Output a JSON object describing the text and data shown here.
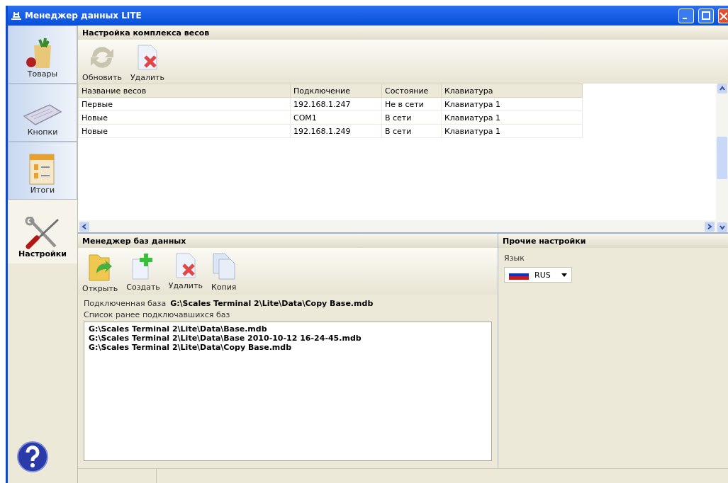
{
  "window": {
    "title": "Менеджер данных LITE"
  },
  "sidebar": {
    "items": [
      {
        "label": "Товары",
        "kind": "goods",
        "selected": false
      },
      {
        "label": "Кнопки",
        "kind": "keyboard",
        "selected": false
      },
      {
        "label": "Итоги",
        "kind": "totals",
        "selected": false
      },
      {
        "label": "Настройки",
        "kind": "tools",
        "selected": true
      }
    ]
  },
  "scales_panel": {
    "title": "Настройка комплекса весов",
    "toolbar": [
      {
        "label": "Обновить",
        "kind": "refresh"
      },
      {
        "label": "Удалить",
        "kind": "delete"
      }
    ],
    "table": {
      "columns": [
        "Название весов",
        "Подключение",
        "Состояние",
        "Клавиатура"
      ],
      "rows": [
        [
          "Первые",
          "192.168.1.247",
          "Не в сети",
          "Клавиатура 1"
        ],
        [
          "Новые",
          "COM1",
          "В сети",
          "Клавиатура 1"
        ],
        [
          "Новые",
          "192.168.1.249",
          "В сети",
          "Клавиатура 1"
        ]
      ]
    }
  },
  "db_panel": {
    "title": "Менеджер баз данных",
    "toolbar": [
      {
        "label": "Открыть",
        "kind": "open"
      },
      {
        "label": "Создать",
        "kind": "create"
      },
      {
        "label": "Удалить",
        "kind": "delete"
      },
      {
        "label": "Копия",
        "kind": "copy"
      }
    ],
    "connected_label": "Подключенная база",
    "connected_value": "G:\\Scales Terminal 2\\Lite\\Data\\Copy Base.mdb",
    "history_label": "Список ранее подключавшихся баз",
    "history": [
      "G:\\Scales Terminal 2\\Lite\\Data\\Base.mdb",
      "G:\\Scales Terminal 2\\Lite\\Data\\Base 2010-10-12 16-24-45.mdb",
      "G:\\Scales Terminal 2\\Lite\\Data\\Copy Base.mdb"
    ]
  },
  "other_panel": {
    "title": "Прочие настройки",
    "language_label": "Язык",
    "language_value": "RUS"
  }
}
